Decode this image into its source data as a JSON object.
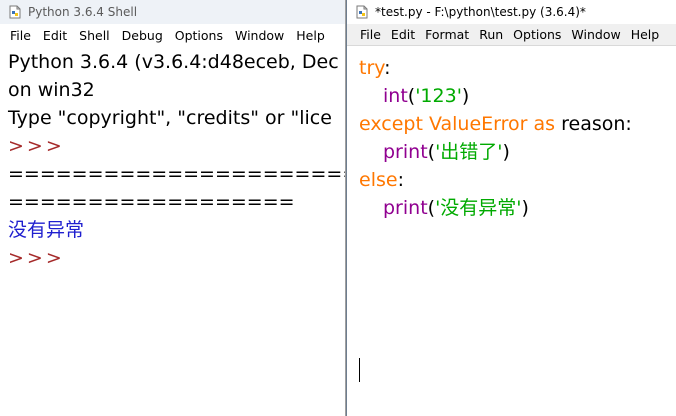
{
  "shell": {
    "title": "Python 3.6.4 Shell",
    "menu": [
      "File",
      "Edit",
      "Shell",
      "Debug",
      "Options",
      "Window",
      "Help"
    ],
    "lines": {
      "banner1": "Python 3.6.4 (v3.6.4:d48eceb, Dec",
      "banner2": "on win32",
      "banner3": "Type \"copyright\", \"credits\" or \"lice",
      "prompt1": ">>>",
      "restart1": "=====================================",
      "restart2": "==================",
      "output": "没有异常",
      "prompt2": ">>>"
    }
  },
  "editor": {
    "title": "*test.py - F:\\python\\test.py (3.6.4)*",
    "menu": [
      "File",
      "Edit",
      "Format",
      "Run",
      "Options",
      "Window",
      "Help"
    ],
    "code": {
      "l1_kw": "try",
      "l1_punct": ":",
      "l2_func": "int",
      "l2_open": "(",
      "l2_str": "'123'",
      "l2_close": ")",
      "l3_kw1": "except",
      "l3_exc": "ValueError",
      "l3_kw2": "as",
      "l3_name": "reason:",
      "l4_func": "print",
      "l4_open": "(",
      "l4_str": "'出错了'",
      "l4_close": ")",
      "l5_kw": "else",
      "l5_punct": ":",
      "l6_func": "print",
      "l6_open": "(",
      "l6_str": "'没有异常'",
      "l6_close": ")"
    }
  },
  "colors": {
    "keyword": "#ff7700",
    "builtin": "#900090",
    "string": "#00aa00",
    "prompt": "#a52a2a",
    "stdout": "#1f1fcf"
  }
}
